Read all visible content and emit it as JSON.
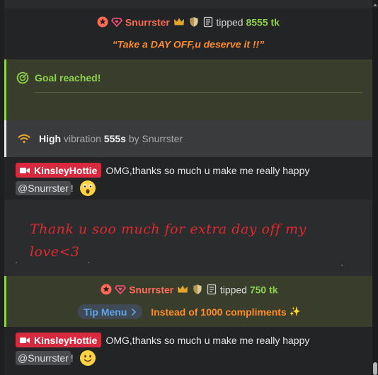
{
  "tip_event_1": {
    "username": "Snurrster",
    "action": "tipped",
    "amount": "8555 tk",
    "message": "“Take a DAY OFF,u deserve it !!”",
    "icons": [
      "star-badge-icon",
      "diamond-heart-icon",
      "crown-icon",
      "shield-icon",
      "document-icon"
    ]
  },
  "goal": {
    "label": "Goal reached!",
    "icon": "target-check-icon"
  },
  "vibration": {
    "level": "High",
    "word": "vibration",
    "duration": "555s",
    "by": "by",
    "username": "Snurrster",
    "icon": "wifi-signal-icon"
  },
  "message_1": {
    "badge_user": "KinsleyHottie",
    "text": "OMG,thanks so much u make me really happy",
    "mention": "@Snurrster",
    "punct": "!",
    "emoji": "astonished-face-emoji"
  },
  "handwritten": {
    "text": "Thank u soo much for extra day off my love<3"
  },
  "tip_event_2": {
    "username": "Snurrster",
    "action": "tipped",
    "amount": "750 tk",
    "tip_menu_label": "Tip Menu",
    "tip_menu_item": "Instead of 1000 compliments",
    "sparkle": "✨"
  },
  "message_2": {
    "badge_user": "KinsleyHottie",
    "text": "OMG,thanks so much u make me really happy",
    "mention": "@Snurrster",
    "punct": "!",
    "emoji": "slightly-smiling-face-emoji"
  },
  "colors": {
    "username_red": "#ff6b57",
    "tip_green": "#8fd24b",
    "message_orange": "#ff8c2a",
    "badge_red": "#d8293f",
    "goal_bg": "#393e2c",
    "handwriting_red": "#e0292e"
  }
}
